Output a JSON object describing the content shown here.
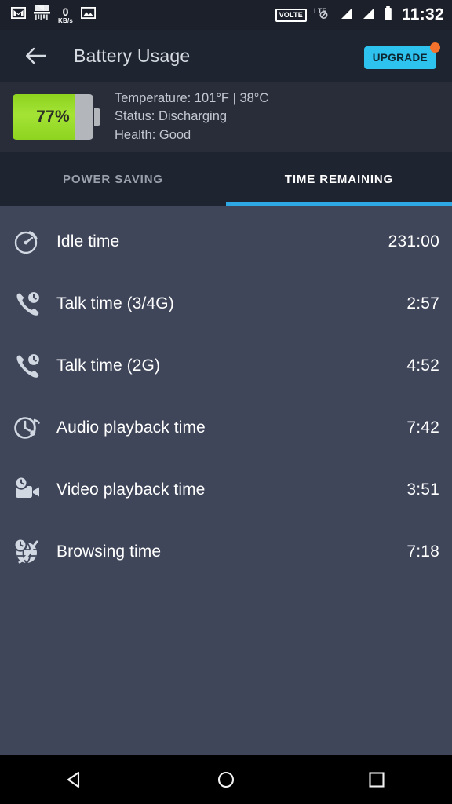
{
  "status_bar": {
    "left_icons": [
      {
        "name": "gmail-icon",
        "label": "M"
      },
      {
        "name": "file-shredder-icon",
        "label": ""
      },
      {
        "name": "network-speed-indicator",
        "value": "0",
        "unit": "KB/s"
      },
      {
        "name": "gallery-photo-icon",
        "label": ""
      }
    ],
    "volte_label": "VOLTE",
    "lte_label": "LTE",
    "signal_bars_count": 2,
    "battery_icon": "battery-icon",
    "time": "11:32"
  },
  "app_bar": {
    "back_icon": "back-arrow-icon",
    "title": "Battery Usage",
    "upgrade_label": "UPGRADE",
    "upgrade_color": "#2ec2ef",
    "badge_color": "#f4722b"
  },
  "battery": {
    "percent_label": "77%",
    "percent_value": 77,
    "fill_color": "#9bdb28",
    "temperature": "Temperature: 101°F | 38°C",
    "status": "Status: Discharging",
    "health": "Health: Good"
  },
  "tabs": {
    "items": [
      {
        "label": "POWER SAVING",
        "active": false
      },
      {
        "label": "TIME REMAINING",
        "active": true
      }
    ],
    "indicator_color": "#2ea9e5"
  },
  "list": {
    "rows": [
      {
        "icon": "idle-gauge-icon",
        "label": "Idle time",
        "value": "231:00"
      },
      {
        "icon": "phone-clock-icon",
        "label": "Talk time (3/4G)",
        "value": "2:57"
      },
      {
        "icon": "phone-clock-icon",
        "label": "Talk time (2G)",
        "value": "4:52"
      },
      {
        "icon": "audio-clock-icon",
        "label": "Audio playback time",
        "value": "7:42"
      },
      {
        "icon": "video-clock-icon",
        "label": "Video playback time",
        "value": "3:51"
      },
      {
        "icon": "globe-clock-icon",
        "label": "Browsing time",
        "value": "7:18"
      }
    ]
  },
  "nav_bar": {
    "back": "nav-back-icon",
    "home": "nav-home-icon",
    "recents": "nav-recents-icon"
  }
}
